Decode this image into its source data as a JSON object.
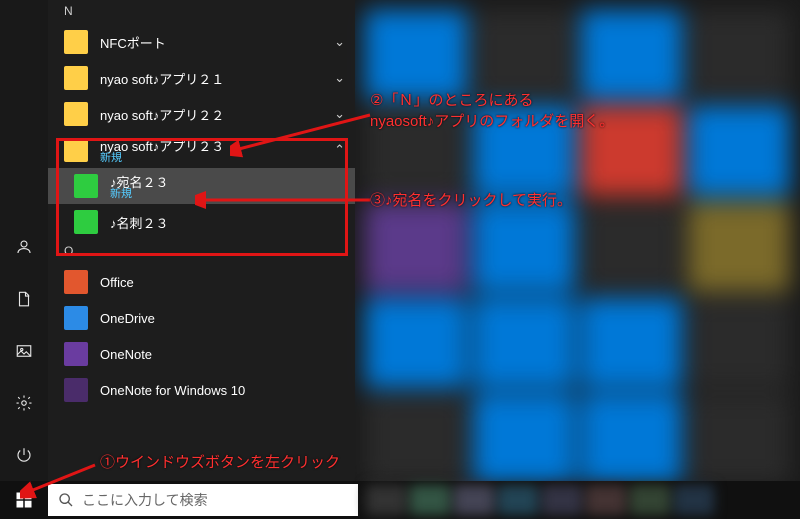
{
  "sections": {
    "N": "N",
    "O": "O"
  },
  "apps": {
    "nfc": "NFCポート",
    "nyao21": "nyao soft♪アプリ２１",
    "nyao22": "nyao soft♪アプリ２２",
    "nyao23": "nyao soft♪アプリ２３",
    "nyao23_sub": "新規",
    "atena23": "♪宛名２３",
    "atena23_sub": "新規",
    "meishi23": "♪名刺２３",
    "office": "Office",
    "onedrive": "OneDrive",
    "onenote": "OneNote",
    "onenote10": "OneNote for Windows 10"
  },
  "annotations": {
    "step1": "①ウインドウズボタンを左クリック",
    "step2a": "②「Ｎ」のところにある",
    "step2b": "nyaosoft♪アプリのフォルダを開く。",
    "step3": "③♪宛名をクリックして実行。"
  },
  "search": {
    "placeholder": "ここに入力して検索"
  }
}
